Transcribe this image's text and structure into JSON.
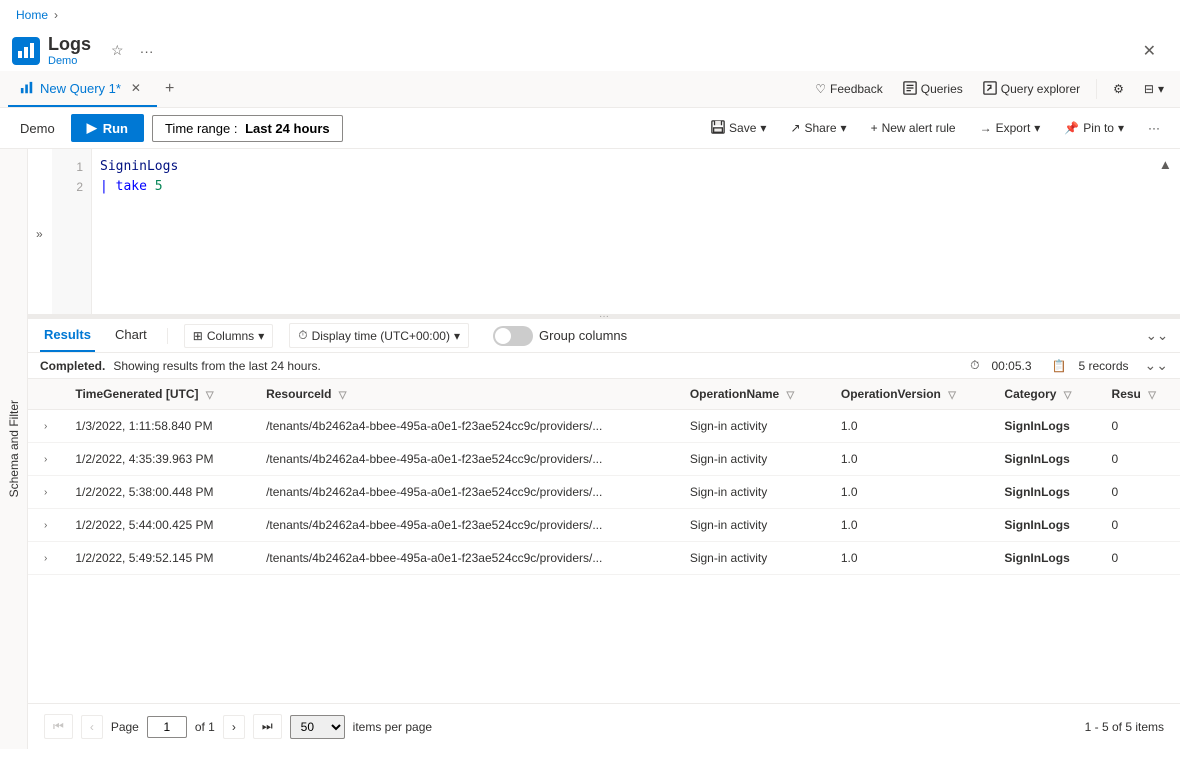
{
  "breadcrumb": {
    "home": "Home"
  },
  "header": {
    "title": "Logs",
    "subtitle": "Demo",
    "star_label": "★",
    "more_label": "···",
    "close_label": "✕"
  },
  "tabs": {
    "active_tab": "New Query 1*",
    "active_tab_close": "✕",
    "add_tab": "+",
    "right_actions": [
      {
        "id": "feedback",
        "label": "Feedback",
        "icon": "♡"
      },
      {
        "id": "queries",
        "label": "Queries",
        "icon": "≡"
      },
      {
        "id": "query-explorer",
        "label": "Query explorer",
        "icon": "⬜"
      }
    ]
  },
  "toolbar": {
    "workspace": "Demo",
    "run_label": "▶  Run",
    "time_range_label": "Time range :",
    "time_range_value": "Last 24 hours",
    "save_label": "Save",
    "share_label": "Share",
    "alert_label": "New alert rule",
    "export_label": "Export",
    "pinto_label": "Pin to",
    "more_label": "···"
  },
  "editor": {
    "lines": [
      {
        "num": "1",
        "content_parts": [
          {
            "text": "SigninLogs",
            "class": "kql-table"
          }
        ]
      },
      {
        "num": "2",
        "content_parts": [
          {
            "text": "| ",
            "class": "kql-pipe"
          },
          {
            "text": "take ",
            "class": "kql-keyword"
          },
          {
            "text": "5",
            "class": "kql-number"
          }
        ]
      }
    ]
  },
  "results": {
    "tabs": [
      "Results",
      "Chart"
    ],
    "active_tab": "Results",
    "columns_label": "Columns",
    "display_time_label": "Display time (UTC+00:00)",
    "group_columns_label": "Group columns",
    "status_text": "Completed.",
    "status_detail": " Showing results from the last 24 hours.",
    "duration": "00:05.3",
    "records": "5 records",
    "expand_all_label": "⌄⌄",
    "columns": [
      {
        "id": "expand",
        "label": ""
      },
      {
        "id": "TimeGenerated",
        "label": "TimeGenerated [UTC]",
        "filterable": true
      },
      {
        "id": "ResourceId",
        "label": "ResourceId",
        "filterable": true
      },
      {
        "id": "OperationName",
        "label": "OperationName",
        "filterable": true
      },
      {
        "id": "OperationVersion",
        "label": "OperationVersion",
        "filterable": true
      },
      {
        "id": "Category",
        "label": "Category",
        "filterable": true
      },
      {
        "id": "Result",
        "label": "Resu",
        "filterable": true
      }
    ],
    "rows": [
      {
        "TimeGenerated": "1/3/2022, 1:11:58.840 PM",
        "ResourceId": "/tenants/4b2462a4-bbee-495a-a0e1-f23ae524cc9c/providers/...",
        "OperationName": "Sign-in activity",
        "OperationVersion": "1.0",
        "Category": "SignInLogs",
        "Result": "0"
      },
      {
        "TimeGenerated": "1/2/2022, 4:35:39.963 PM",
        "ResourceId": "/tenants/4b2462a4-bbee-495a-a0e1-f23ae524cc9c/providers/...",
        "OperationName": "Sign-in activity",
        "OperationVersion": "1.0",
        "Category": "SignInLogs",
        "Result": "0"
      },
      {
        "TimeGenerated": "1/2/2022, 5:38:00.448 PM",
        "ResourceId": "/tenants/4b2462a4-bbee-495a-a0e1-f23ae524cc9c/providers/...",
        "OperationName": "Sign-in activity",
        "OperationVersion": "1.0",
        "Category": "SignInLogs",
        "Result": "0"
      },
      {
        "TimeGenerated": "1/2/2022, 5:44:00.425 PM",
        "ResourceId": "/tenants/4b2462a4-bbee-495a-a0e1-f23ae524cc9c/providers/...",
        "OperationName": "Sign-in activity",
        "OperationVersion": "1.0",
        "Category": "SignInLogs",
        "Result": "0"
      },
      {
        "TimeGenerated": "1/2/2022, 5:49:52.145 PM",
        "ResourceId": "/tenants/4b2462a4-bbee-495a-a0e1-f23ae524cc9c/providers/...",
        "OperationName": "Sign-in activity",
        "OperationVersion": "1.0",
        "Category": "SignInLogs",
        "Result": "0"
      }
    ]
  },
  "pagination": {
    "page_label": "Page",
    "current_page": "1",
    "of_label": "of 1",
    "items_per_page": "50",
    "items_per_page_label": "items per page",
    "summary": "1 - 5 of 5 items"
  },
  "side_panel": {
    "label": "Schema and Filter"
  },
  "colors": {
    "accent": "#0078d4",
    "border": "#edebe9",
    "bg_light": "#faf9f8"
  }
}
